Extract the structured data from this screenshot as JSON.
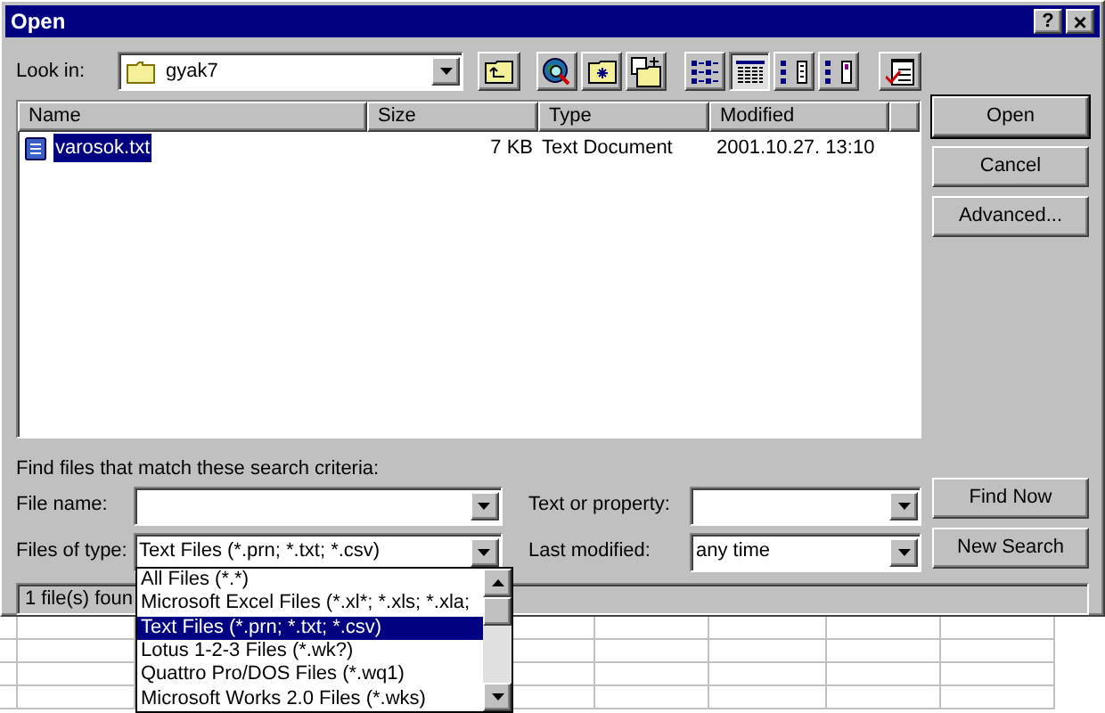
{
  "window": {
    "title": "Open",
    "help_glyph": "?",
    "close_glyph": "×"
  },
  "look_in": {
    "label": "Look in:",
    "value": "gyak7"
  },
  "view_buttons": [
    {
      "selected": false
    },
    {
      "selected": true
    },
    {
      "selected": false
    },
    {
      "selected": false
    }
  ],
  "file_list": {
    "columns": [
      "Name",
      "Size",
      "Type",
      "Modified"
    ],
    "rows": [
      {
        "name": "varosok.txt",
        "size": "7 KB",
        "type": "Text Document",
        "modified": "2001.10.27. 13:10",
        "selected": true
      }
    ]
  },
  "buttons": [
    "Open",
    "Cancel",
    "Advanced..."
  ],
  "search": {
    "heading": "Find files that match these search criteria:",
    "file_name": {
      "label": "File name:"
    },
    "files_of_type": {
      "label": "Files of type:",
      "value": "Text Files (*.prn; *.txt; *.csv)",
      "expanded": true,
      "options": [
        {
          "label": "All Files (*.*)",
          "selected": false
        },
        {
          "label": "Microsoft Excel Files (*.xl*; *.xls; *.xla;",
          "selected": false
        },
        {
          "label": "Text Files (*.prn; *.txt; *.csv)",
          "selected": true
        },
        {
          "label": "Lotus 1-2-3 Files (*.wk?)",
          "selected": false
        },
        {
          "label": "Quattro Pro/DOS Files (*.wq1)",
          "selected": false
        },
        {
          "label": "Microsoft Works 2.0 Files (*.wks)",
          "selected": false
        }
      ]
    },
    "text_or_property": {
      "label": "Text or property:"
    },
    "last_modified": {
      "label": "Last modified:",
      "value": "any time"
    },
    "buttons": [
      "Find Now",
      "New Search"
    ]
  },
  "status": "1 file(s) foun"
}
